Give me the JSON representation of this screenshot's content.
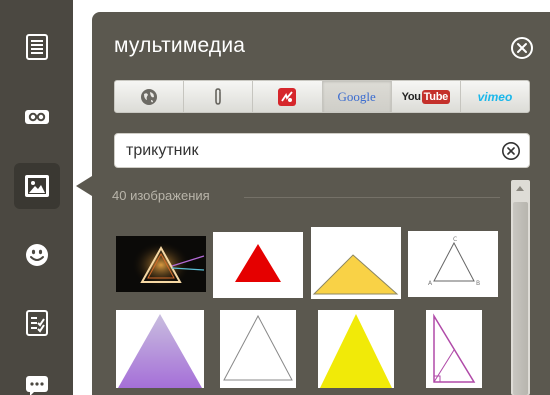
{
  "panel": {
    "title": "мультимедиа",
    "close_icon": "circle-x-icon"
  },
  "toolbar": {
    "items": [
      {
        "icon": "text-lines-icon"
      },
      {
        "icon": "link-icon"
      },
      {
        "icon": "image-icon",
        "active": true
      },
      {
        "icon": "smiley-icon"
      },
      {
        "icon": "checklist-icon"
      },
      {
        "icon": "speech-bubble-icon"
      }
    ]
  },
  "sources": [
    {
      "icon": "globe-icon"
    },
    {
      "icon": "paperclip-icon"
    },
    {
      "icon": "flickr-like-icon"
    },
    {
      "label": "Google",
      "active": true
    },
    {
      "label_you": "You",
      "label_tube": "Tube"
    },
    {
      "label": "vimeo"
    }
  ],
  "search": {
    "value": "трикутник",
    "clear_icon": "circle-x-icon"
  },
  "results": {
    "count_label": "40 изображения"
  },
  "colors": {
    "toolbar_bg": "#4b4841",
    "panel_bg": "#5b584f",
    "google_blue": "#3b6ccf",
    "youtube_red": "#c4302b",
    "vimeo_blue": "#1ab7ea"
  }
}
